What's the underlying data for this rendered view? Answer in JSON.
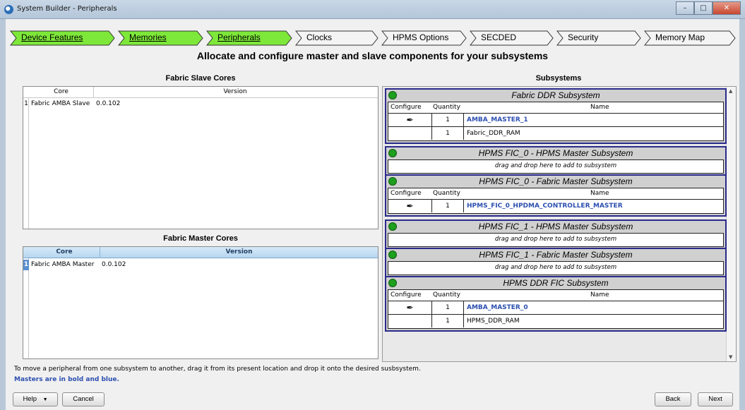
{
  "window": {
    "title": "System Builder - Peripherals"
  },
  "steps": [
    {
      "label": "Device Features",
      "state": "done"
    },
    {
      "label": "Memories",
      "state": "done"
    },
    {
      "label": "Peripherals",
      "state": "current"
    },
    {
      "label": "Clocks",
      "state": "todo"
    },
    {
      "label": "HPMS Options",
      "state": "todo"
    },
    {
      "label": "SECDED",
      "state": "todo"
    },
    {
      "label": "Security",
      "state": "todo"
    },
    {
      "label": "Memory Map",
      "state": "todo"
    }
  ],
  "heading": "Allocate and configure master and slave components for your subsystems",
  "slave_cores": {
    "title": "Fabric Slave Cores",
    "columns": [
      "Core",
      "Version"
    ],
    "rows": [
      {
        "num": "1",
        "core": "Fabric AMBA Slave",
        "version": "0.0.102"
      }
    ]
  },
  "master_cores": {
    "title": "Fabric Master Cores",
    "columns": [
      "Core",
      "Version"
    ],
    "rows": [
      {
        "num": "1",
        "core": "Fabric AMBA Master",
        "version": "0.0.102"
      }
    ]
  },
  "subsystems": {
    "title": "Subsystems",
    "col_configure": "Configure",
    "col_quantity": "Quantity",
    "col_name": "Name",
    "drop_hint": "drag and drop here to add to subsystem",
    "items": [
      {
        "title": "Fabric DDR Subsystem",
        "rows": [
          {
            "qty": "1",
            "name": "AMBA_MASTER_1",
            "master": true
          },
          {
            "qty": "1",
            "name": "Fabric_DDR_RAM",
            "master": false
          }
        ]
      },
      {
        "title": "HPMS FIC_0 - HPMS Master Subsystem",
        "rows": []
      },
      {
        "title": "HPMS FIC_0 - Fabric Master Subsystem",
        "rows": [
          {
            "qty": "1",
            "name": "HPMS_FIC_0_HPDMA_CONTROLLER_MASTER",
            "master": true
          }
        ]
      },
      {
        "title": "HPMS FIC_1 - HPMS Master Subsystem",
        "rows": []
      },
      {
        "title": "HPMS FIC_1 - Fabric Master Subsystem",
        "rows": []
      },
      {
        "title": "HPMS DDR FIC Subsystem",
        "rows": [
          {
            "qty": "1",
            "name": "AMBA_MASTER_0",
            "master": true
          },
          {
            "qty": "1",
            "name": "HPMS_DDR_RAM",
            "master": false
          }
        ]
      }
    ]
  },
  "notes": {
    "move_hint": "To move a peripheral from one subsystem to another, drag it from its present location and drop it onto the desired susbsystem.",
    "masters_hint": "Masters are in bold and blue."
  },
  "buttons": {
    "help": "Help",
    "cancel": "Cancel",
    "back": "Back",
    "next": "Next"
  },
  "colors": {
    "done_step": "#7ee83a",
    "master_text": "#2c4fb0",
    "subsystem_border": "#2a2a8c",
    "status_dot": "#1e9f1e"
  }
}
